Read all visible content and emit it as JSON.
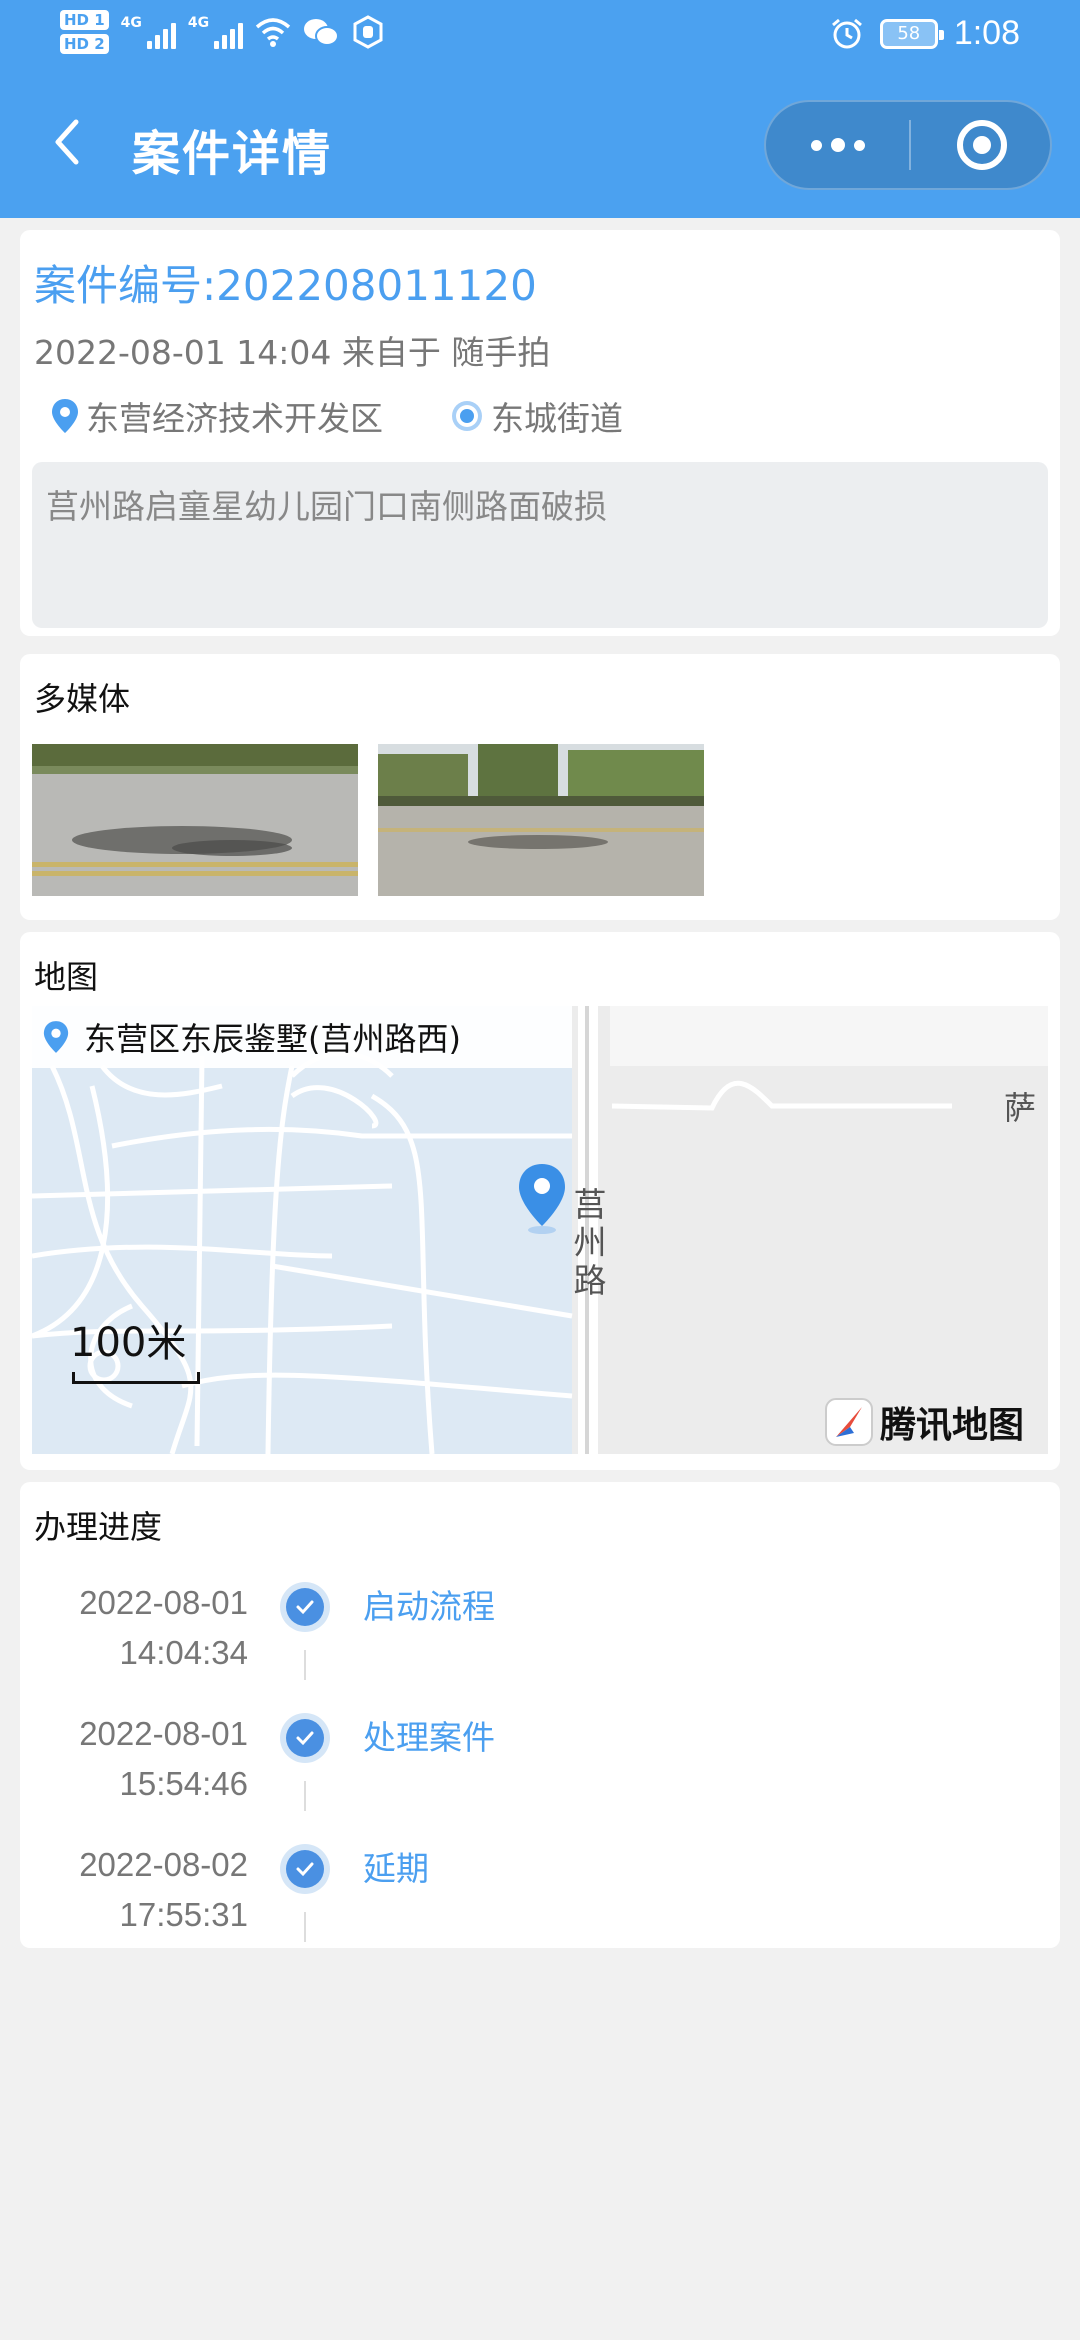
{
  "status_bar": {
    "hd1": "HD 1",
    "hd2": "HD 2",
    "net1": "4G",
    "net2": "4G",
    "battery": "58",
    "time": "1:08"
  },
  "navbar": {
    "title": "案件详情",
    "back_icon": "chevron-left-icon",
    "more_icon": "more-dots-icon",
    "close_icon": "target-circle-icon"
  },
  "case": {
    "number_text": "案件编号:202208011120",
    "meta": "2022-08-01 14:04 来自于 随手拍",
    "district": "东营经济技术开发区",
    "street": "东城街道",
    "description": "莒州路启童星幼儿园门口南侧路面破损"
  },
  "media": {
    "title": "多媒体"
  },
  "map": {
    "title": "地图",
    "address": "东营区东辰鉴墅(莒州路西)",
    "road_label": "莒州路",
    "scale": "100米",
    "corner_text": "萨",
    "logo_text": "腾讯地图"
  },
  "progress": {
    "title": "办理进度",
    "steps": [
      {
        "date": "2022-08-01",
        "time": "14:04:34",
        "label": "启动流程"
      },
      {
        "date": "2022-08-01",
        "time": "15:54:46",
        "label": "处理案件"
      },
      {
        "date": "2022-08-02",
        "time": "17:55:31",
        "label": "延期"
      }
    ]
  },
  "colors": {
    "header": "#4ba1f0",
    "accent": "#4b9ff0",
    "check": "#4a90e2"
  }
}
